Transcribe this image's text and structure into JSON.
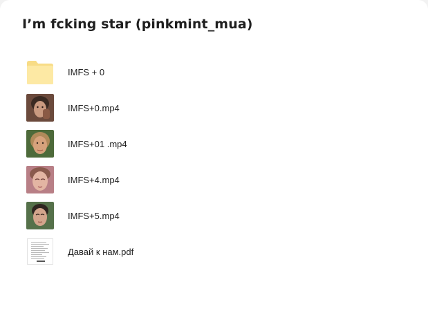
{
  "folder": {
    "title": "I’m fcking star (pinkmint_mua)"
  },
  "items": [
    {
      "type": "folder",
      "name": "IMFS + 0",
      "icon": "folder-icon",
      "color": "#fde9a4"
    },
    {
      "type": "video",
      "name": "IMFS+0.mp4",
      "icon": "video-thumbnail-icon",
      "bg": "#6b4a3c",
      "skin": "#c99a80",
      "hair": "#3a2a22"
    },
    {
      "type": "video",
      "name": "IMFS+01 .mp4",
      "icon": "video-thumbnail-icon",
      "bg": "#4d6a3a",
      "skin": "#d7a27c",
      "hair": "#b08a5a"
    },
    {
      "type": "video",
      "name": "IMFS+4.mp4",
      "icon": "video-thumbnail-icon",
      "bg": "#b87f86",
      "skin": "#e3b5a3",
      "hair": "#8a5a4d"
    },
    {
      "type": "video",
      "name": "IMFS+5.mp4",
      "icon": "video-thumbnail-icon",
      "bg": "#55714a",
      "skin": "#d3a58c",
      "hair": "#2e2520"
    },
    {
      "type": "pdf",
      "name": "Давай к нам.pdf",
      "icon": "pdf-thumbnail-icon"
    }
  ]
}
